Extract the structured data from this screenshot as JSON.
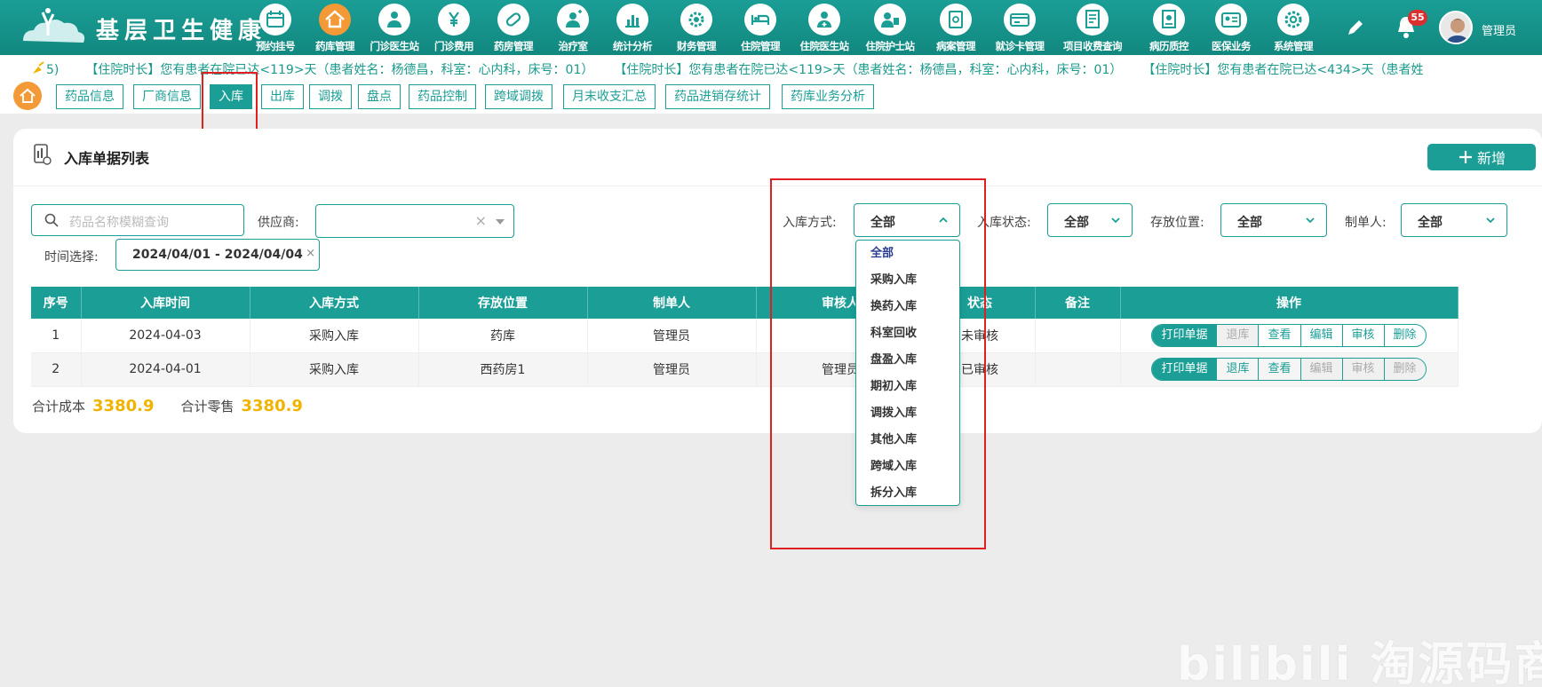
{
  "app": {
    "title": "基层卫生健康"
  },
  "modules": [
    {
      "label": "预约挂号",
      "icon": "appointment-icon",
      "active": false
    },
    {
      "label": "药库管理",
      "icon": "house-icon",
      "active": true
    },
    {
      "label": "门诊医生站",
      "icon": "doctor-icon",
      "active": false
    },
    {
      "label": "门诊费用",
      "icon": "yen-icon",
      "active": false
    },
    {
      "label": "药房管理",
      "icon": "pill-icon",
      "active": false
    },
    {
      "label": "治疗室",
      "icon": "nurse-icon",
      "active": false
    },
    {
      "label": "统计分析",
      "icon": "bar-chart-icon",
      "active": false
    },
    {
      "label": "财务管理",
      "icon": "finance-gear-icon",
      "active": false
    },
    {
      "label": "住院管理",
      "icon": "bed-icon",
      "active": false
    },
    {
      "label": "住院医生站",
      "icon": "hospital-doctor-icon",
      "active": false
    },
    {
      "label": "住院护士站",
      "icon": "nurse-station-icon",
      "active": false
    },
    {
      "label": "病案管理",
      "icon": "medical-record-icon",
      "active": false
    },
    {
      "label": "就诊卡管理",
      "icon": "card-icon",
      "active": false
    },
    {
      "label": "项目收费查询",
      "icon": "fee-query-icon",
      "active": false
    },
    {
      "label": "病历质控",
      "icon": "quality-control-icon",
      "active": false
    },
    {
      "label": "医保业务",
      "icon": "insurance-card-icon",
      "active": false
    },
    {
      "label": "系统管理",
      "icon": "settings-gear-icon",
      "active": false
    }
  ],
  "header": {
    "notification_count": "55",
    "username": "管理员"
  },
  "ticker": {
    "lead": "5)",
    "items": [
      "【住院时长】您有患者在院已达<119>天（患者姓名：杨德昌，科室：心内科，床号：01）",
      "【住院时长】您有患者在院已达<119>天（患者姓名：杨德昌，科室：心内科，床号：01）",
      "【住院时长】您有患者在院已达<434>天（患者姓"
    ]
  },
  "subtabs": [
    {
      "label": "药品信息",
      "active": false
    },
    {
      "label": "厂商信息",
      "active": false
    },
    {
      "label": "入库",
      "active": true
    },
    {
      "label": "出库",
      "active": false
    },
    {
      "label": "调拨",
      "active": false
    },
    {
      "label": "盘点",
      "active": false
    },
    {
      "label": "药品控制",
      "active": false
    },
    {
      "label": "跨域调拨",
      "active": false
    },
    {
      "label": "月末收支汇总",
      "active": false
    },
    {
      "label": "药品进销存统计",
      "active": false
    },
    {
      "label": "药库业务分析",
      "active": false
    }
  ],
  "card": {
    "title": "入库单据列表",
    "new_button": "新增"
  },
  "filters": {
    "search_placeholder": "药品名称模糊查询",
    "supplier_label": "供应商:",
    "supplier_clear": "×",
    "method_label": "入库方式:",
    "method_value": "全部",
    "status_label": "入库状态:",
    "status_value": "全部",
    "location_label": "存放位置:",
    "location_value": "全部",
    "maker_label": "制单人:",
    "maker_value": "全部",
    "time_label": "时间选择:",
    "date_range": "2024/04/01 - 2024/04/04",
    "date_clear": "×"
  },
  "table": {
    "headers": [
      "序号",
      "入库时间",
      "入库方式",
      "存放位置",
      "制单人",
      "审核人",
      "状态",
      "备注",
      "操作"
    ],
    "rows": [
      {
        "no": "1",
        "time": "2024-04-03",
        "method": "采购入库",
        "location": "药库",
        "maker": "管理员",
        "auditor": "",
        "status": "未审核",
        "status_kind": "pending",
        "note": "",
        "ops": [
          {
            "label": "打印单据",
            "kind": "primary"
          },
          {
            "label": "退库",
            "kind": "disabled"
          },
          {
            "label": "查看",
            "kind": "normal"
          },
          {
            "label": "编辑",
            "kind": "normal"
          },
          {
            "label": "审核",
            "kind": "normal"
          },
          {
            "label": "删除",
            "kind": "normal"
          }
        ]
      },
      {
        "no": "2",
        "time": "2024-04-01",
        "method": "采购入库",
        "location": "西药房1",
        "maker": "管理员",
        "auditor": "管理员",
        "status": "已审核",
        "status_kind": "ok",
        "note": "",
        "ops": [
          {
            "label": "打印单据",
            "kind": "primary"
          },
          {
            "label": "退库",
            "kind": "normal"
          },
          {
            "label": "查看",
            "kind": "normal"
          },
          {
            "label": "编辑",
            "kind": "disabled"
          },
          {
            "label": "审核",
            "kind": "disabled"
          },
          {
            "label": "删除",
            "kind": "disabled"
          }
        ]
      }
    ]
  },
  "totals": {
    "cost_label": "合计成本",
    "cost_value": "3380.9",
    "retail_label": "合计零售",
    "retail_value": "3380.9"
  },
  "dropdown": {
    "options": [
      "全部",
      "采购入库",
      "换药入库",
      "科室回收",
      "盘盈入库",
      "期初入库",
      "调拨入库",
      "其他入库",
      "跨域入库",
      "拆分入库"
    ],
    "selected": "全部"
  },
  "watermark": "bilibili 淘源码商城",
  "colors": {
    "primary": "#1a9e96",
    "accent": "#f39a36",
    "pending": "#e6b43a",
    "highlight": "#e02020",
    "total": "#f0b400"
  }
}
